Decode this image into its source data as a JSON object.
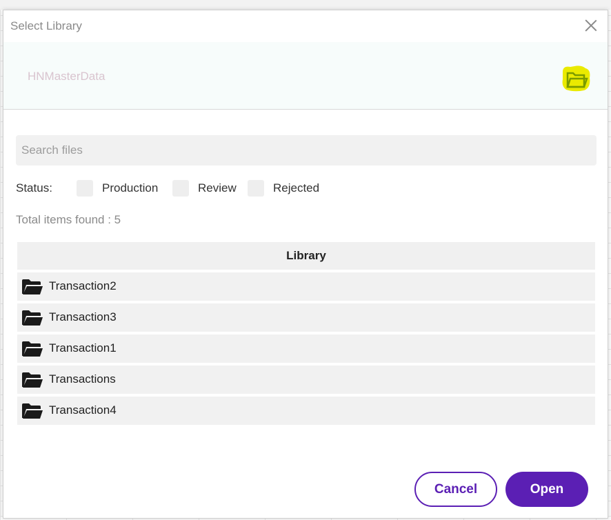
{
  "dialog": {
    "title": "Select Library",
    "library_name": "HNMasterData",
    "search": {
      "placeholder": "Search files",
      "value": ""
    },
    "status": {
      "label": "Status:",
      "options": [
        {
          "label": "Production",
          "checked": false
        },
        {
          "label": "Review",
          "checked": false
        },
        {
          "label": "Rejected",
          "checked": false
        }
      ]
    },
    "total_items": "Total items found : 5",
    "table": {
      "header": "Library",
      "rows": [
        {
          "name": "Transaction2",
          "icon": "folder-open-icon"
        },
        {
          "name": "Transaction3",
          "icon": "folder-open-icon"
        },
        {
          "name": "Transaction1",
          "icon": "folder-open-icon"
        },
        {
          "name": "Transactions",
          "icon": "folder-open-icon"
        },
        {
          "name": "Transaction4",
          "icon": "folder-open-icon"
        }
      ]
    },
    "buttons": {
      "cancel": "Cancel",
      "open": "Open"
    }
  },
  "colors": {
    "accent": "#5b1fb4",
    "browse_icon": "#e8e800",
    "library_name": "#d9c4cf"
  }
}
